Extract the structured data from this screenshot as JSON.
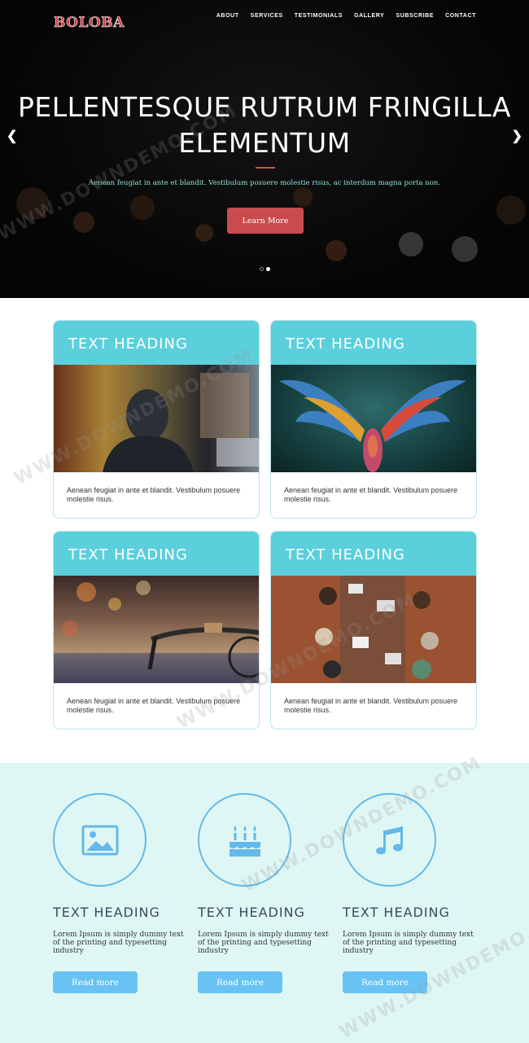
{
  "brand": {
    "logo": "BOLOBA"
  },
  "nav": {
    "items": [
      "ABOUT",
      "SERVICES",
      "TESTIMONIALS",
      "GALLERY",
      "SUBSCRIBE",
      "CONTACT"
    ]
  },
  "hero": {
    "title_line1": "PELLENTESQUE RUTRUM FRINGILLA",
    "title_line2": "ELEMENTUM",
    "subtitle": "Aenean feugiat in ante et blandit. Vestibulum posuere molestie risus, ac interdum magna porta non.",
    "button": "Learn More",
    "prev_icon": "chevron-left-icon",
    "next_icon": "chevron-right-icon"
  },
  "cards": [
    {
      "heading": "TEXT HEADING",
      "text": "Aenean feugiat in ante et blandit. Vestibulum posuere molestie risus."
    },
    {
      "heading": "TEXT HEADING",
      "text": "Aenean feugiat in ante et blandit. Vestibulum posuere molestie risus."
    },
    {
      "heading": "TEXT HEADING",
      "text": "Aenean feugiat in ante et blandit. Vestibulum posuere molestie risus."
    },
    {
      "heading": "TEXT HEADING",
      "text": "Aenean feugiat in ante et blandit. Vestibulum posuere molestie risus."
    }
  ],
  "features": [
    {
      "icon": "image-icon",
      "heading": "TEXT HEADING",
      "text": "Lorem Ipsum is simply dummy text of the printing and typesetting industry",
      "button": "Read more"
    },
    {
      "icon": "cake-icon",
      "heading": "TEXT HEADING",
      "text": "Lorem Ipsum is simply dummy text of the printing and typesetting industry",
      "button": "Read more"
    },
    {
      "icon": "music-icon",
      "heading": "TEXT HEADING",
      "text": "Lorem Ipsum is simply dummy text of the printing and typesetting industry",
      "button": "Read more"
    }
  ],
  "watermark": {
    "text": "WWW.DOWNDEMO.COM"
  },
  "colors": {
    "accent": "#5bcfdc",
    "hero_button": "#c84c4e",
    "feature_button": "#68c3f4",
    "feature_bg": "#dff7f4"
  }
}
